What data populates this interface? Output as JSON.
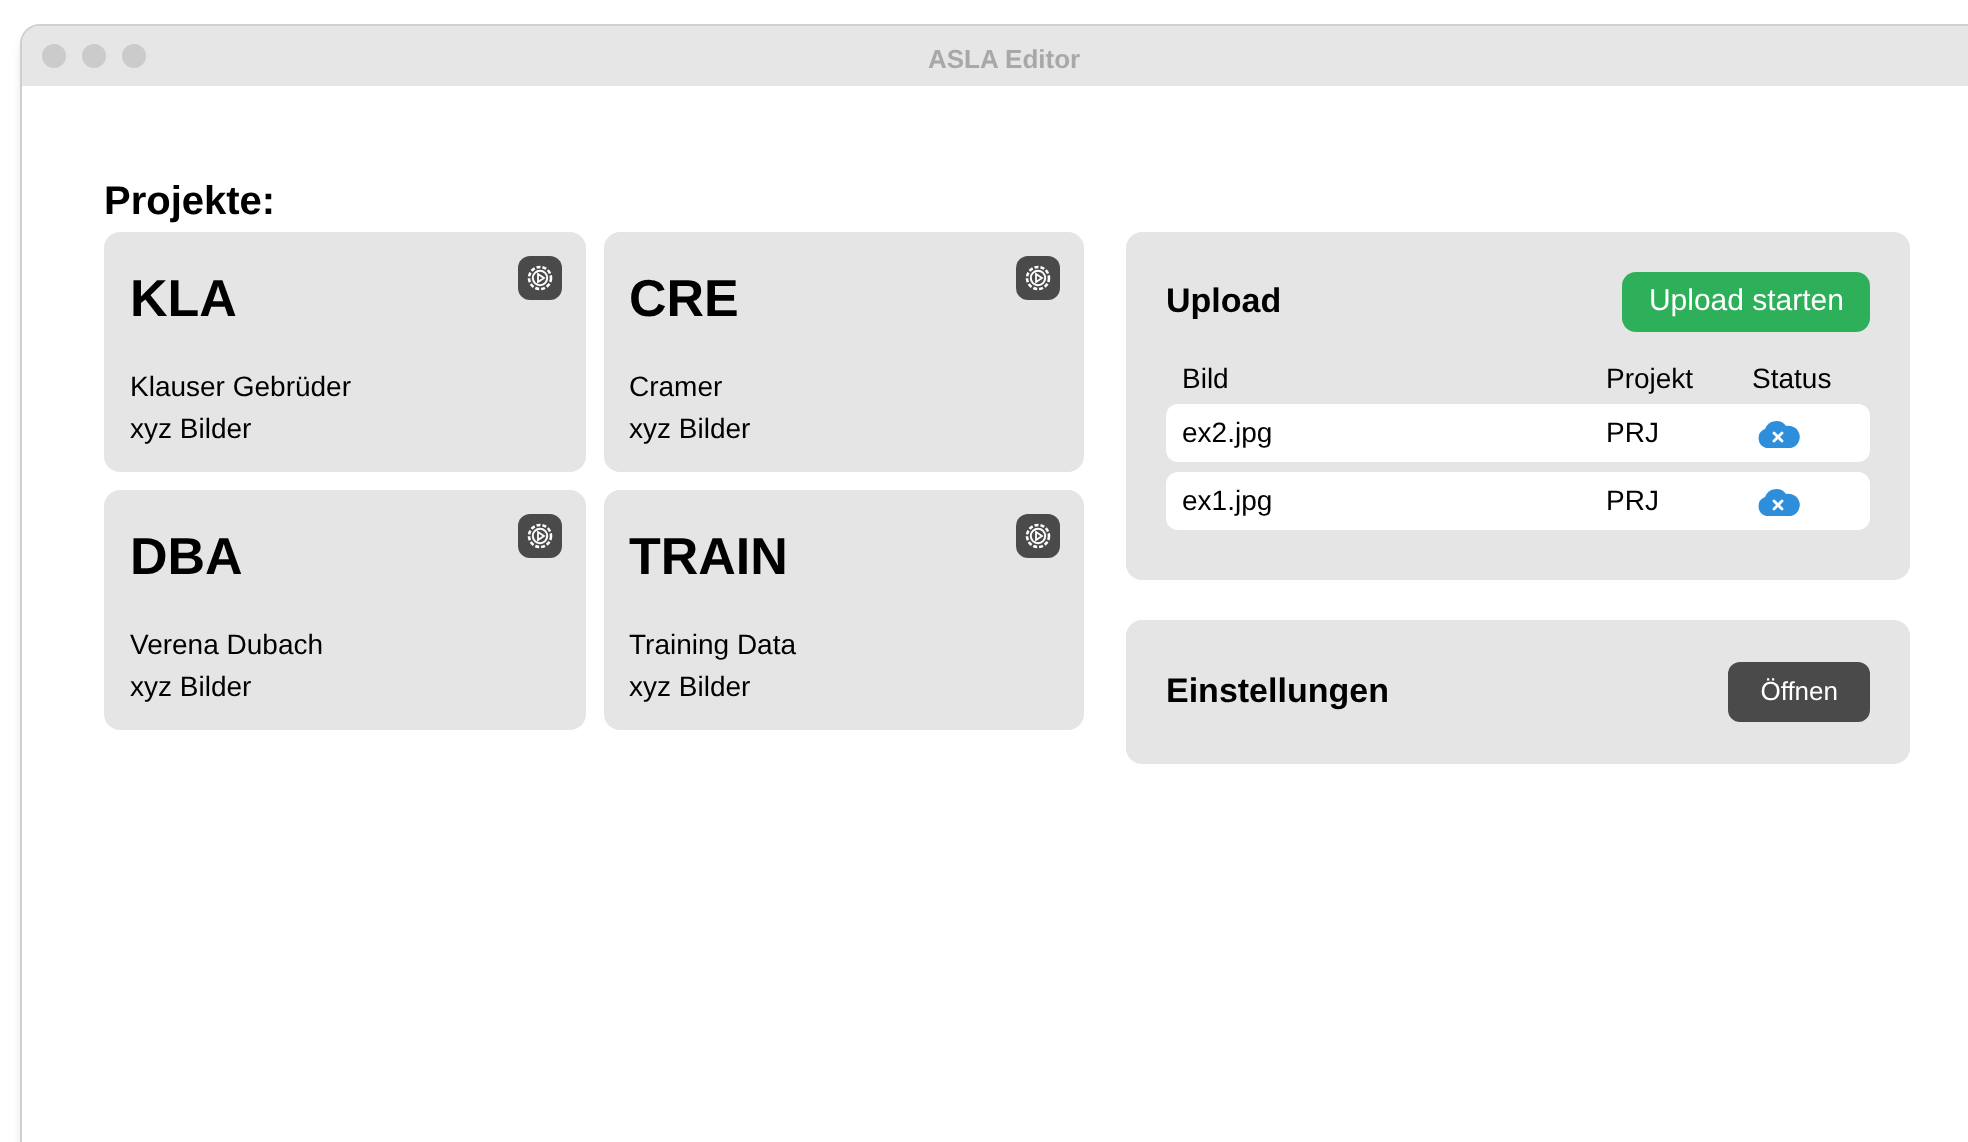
{
  "window": {
    "title": "ASLA Editor"
  },
  "projects_heading": "Projekte:",
  "projects": [
    {
      "code": "KLA",
      "name": "Klauser Gebrüder",
      "images": "xyz Bilder"
    },
    {
      "code": "CRE",
      "name": "Cramer",
      "images": "xyz Bilder"
    },
    {
      "code": "DBA",
      "name": "Verena Dubach",
      "images": "xyz Bilder"
    },
    {
      "code": "TRAIN",
      "name": "Training Data",
      "images": "xyz Bilder"
    }
  ],
  "upload": {
    "title": "Upload",
    "button": "Upload starten",
    "columns": [
      "Bild",
      "Projekt",
      "Status"
    ],
    "rows": [
      {
        "image": "ex2.jpg",
        "project": "PRJ",
        "failed": true
      },
      {
        "image": "ex1.jpg",
        "project": "PRJ",
        "failed": true
      }
    ]
  },
  "settings": {
    "title": "Einstellungen",
    "button": "Öffnen"
  }
}
